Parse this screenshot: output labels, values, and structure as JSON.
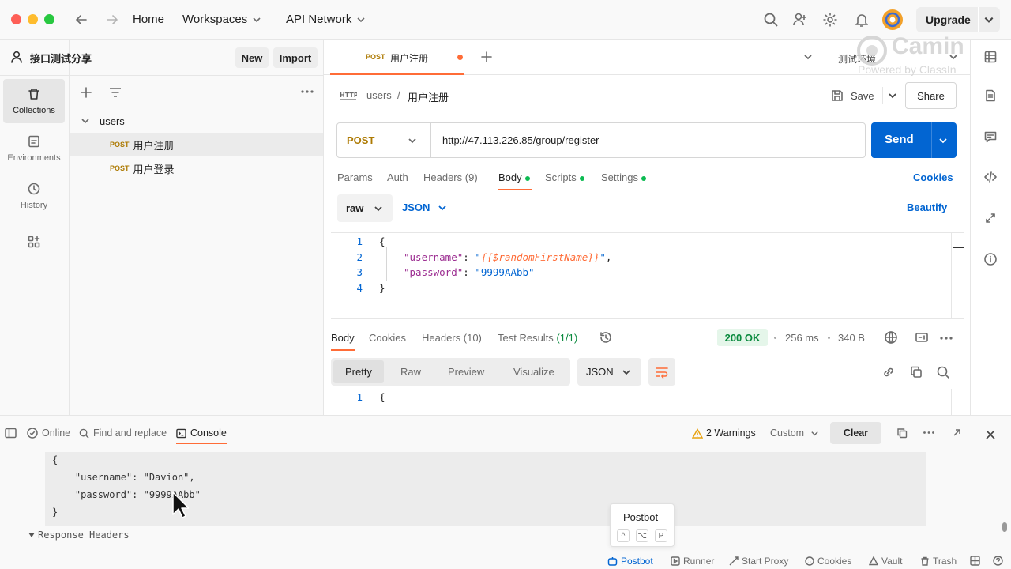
{
  "nav": {
    "home": "Home",
    "workspaces": "Workspaces",
    "api_network": "API Network",
    "upgrade": "Upgrade"
  },
  "rail": {
    "collections": "Collections",
    "environments": "Environments",
    "history": "History"
  },
  "sidebar": {
    "workspace_name": "接口测试分享",
    "new_label": "New",
    "import_label": "Import",
    "folder": "users",
    "requests": [
      {
        "method": "POST",
        "name": "用户注册"
      },
      {
        "method": "POST",
        "name": "用户登录"
      }
    ]
  },
  "tab": {
    "method": "POST",
    "name": "用户注册",
    "env": "测试环境"
  },
  "breadcrumb": {
    "parent": "users",
    "sep": "/",
    "current": "用户注册"
  },
  "actions": {
    "save": "Save",
    "share": "Share"
  },
  "request": {
    "method": "POST",
    "url": "http://47.113.226.85/group/register",
    "send": "Send"
  },
  "req_tabs": {
    "params": "Params",
    "auth": "Auth",
    "headers": "Headers",
    "headers_count": "(9)",
    "body": "Body",
    "scripts": "Scripts",
    "settings": "Settings",
    "cookies": "Cookies"
  },
  "body_opts": {
    "mode": "raw",
    "lang": "JSON",
    "beautify": "Beautify"
  },
  "code_lines": [
    {
      "n": "1",
      "t": "{"
    },
    {
      "n": "2",
      "k": "\"username\"",
      "c": ": ",
      "q1": "\"",
      "v": "{{$randomFirstName}}",
      "q2": "\"",
      "e": ","
    },
    {
      "n": "3",
      "k": "\"password\"",
      "c": ": ",
      "s": "\"9999AAbb\""
    },
    {
      "n": "4",
      "t": "}"
    }
  ],
  "resp_tabs": {
    "body": "Body",
    "cookies": "Cookies",
    "headers": "Headers",
    "headers_count": "(10)",
    "tests": "Test Results",
    "tests_count": "(1/1)"
  },
  "resp_meta": {
    "status": "200 OK",
    "time": "256 ms",
    "size": "340 B"
  },
  "resp_views": {
    "pretty": "Pretty",
    "raw": "Raw",
    "preview": "Preview",
    "visualize": "Visualize",
    "lang": "JSON"
  },
  "resp_line": {
    "n": "1",
    "t": "{"
  },
  "footer_tabs": {
    "online": "Online",
    "find": "Find and replace",
    "console": "Console"
  },
  "console_bar": {
    "warnings": "2 Warnings",
    "filter": "Custom",
    "clear": "Clear"
  },
  "console_lines": [
    "{",
    "    \"username\": \"Davion\",",
    "    \"password\": \"9999AAbb\"",
    "}"
  ],
  "console_section": "Response Headers",
  "postbot_popup": {
    "title": "Postbot",
    "keys": [
      "^",
      "⌥",
      "P"
    ]
  },
  "statusbar": {
    "postbot": "Postbot",
    "runner": "Runner",
    "proxy": "Start Proxy",
    "cookies": "Cookies",
    "vault": "Vault",
    "trash": "Trash"
  },
  "watermark": {
    "brand": "Camin",
    "sub": "Powered by ClassIn"
  }
}
